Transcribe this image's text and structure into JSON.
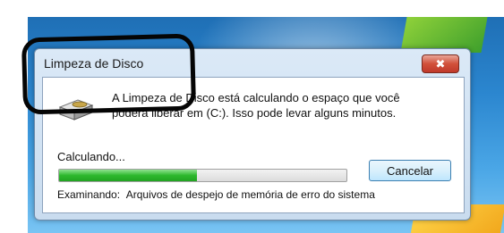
{
  "window": {
    "title": "Limpeza de Disco",
    "close_symbol": "✖",
    "message_line1": "A Limpeza de Disco está calculando o espaço que você",
    "message_line2": "poderá liberar em  (C:). Isso pode levar alguns minutos.",
    "calculating_label": "Calculando...",
    "progress_fraction": 0.48,
    "cancel_label": "Cancelar",
    "status_label": "Examinando:",
    "status_value": "Arquivos de despejo de memória de erro do sistema"
  },
  "colors": {
    "progress_fill": "#2db82d",
    "close_button": "#c0392b",
    "annotation": "#050505"
  },
  "icons": {
    "drive": "disk-cleanup-drive-icon",
    "close": "close-icon"
  }
}
